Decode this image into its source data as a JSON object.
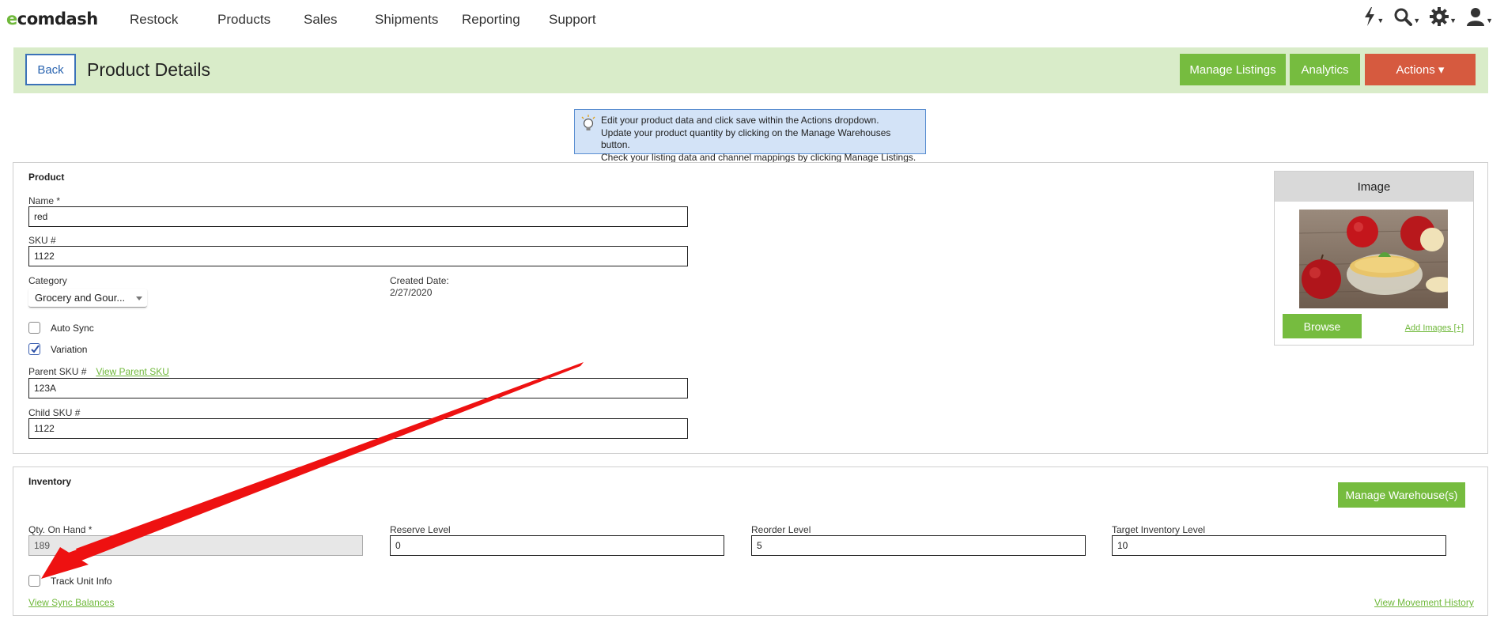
{
  "nav": {
    "logo_e": "e",
    "logo_rest": "comdash",
    "items": [
      "Restock",
      "Products",
      "Sales",
      "Shipments",
      "Reporting",
      "Support"
    ],
    "icons": [
      "lightning-icon",
      "search-icon",
      "gear-icon",
      "user-icon"
    ]
  },
  "header": {
    "back_label": "Back",
    "title": "Product Details",
    "manage_listings_label": "Manage Listings",
    "analytics_label": "Analytics",
    "actions_label": "Actions ▾"
  },
  "info": {
    "line1": "Edit your product data and click save within the Actions dropdown.",
    "line2": "Update your product quantity by clicking on the Manage Warehouses button.",
    "line3": "Check your listing data and channel mappings by clicking Manage Listings."
  },
  "product": {
    "section_title": "Product",
    "name_label": "Name *",
    "name_value": "red",
    "sku_label": "SKU #",
    "sku_value": "1122",
    "category_label": "Category",
    "category_value": "Grocery and Gour...",
    "created_label": "Created Date:",
    "created_value": "2/27/2020",
    "auto_sync_label": "Auto Sync",
    "auto_sync_checked": false,
    "variation_label": "Variation",
    "variation_checked": true,
    "parent_sku_label": "Parent SKU #",
    "view_parent_sku": "View Parent SKU",
    "parent_sku_value": "123A",
    "child_sku_label": "Child SKU #",
    "child_sku_value": "1122"
  },
  "image_panel": {
    "title": "Image",
    "browse_label": "Browse",
    "add_images_label": "Add Images [+]"
  },
  "inventory": {
    "section_title": "Inventory",
    "manage_warehouses_label": "Manage Warehouse(s)",
    "qty_label": "Qty. On Hand *",
    "qty_value": "189",
    "reserve_label": "Reserve Level",
    "reserve_value": "0",
    "reorder_label": "Reorder Level",
    "reorder_value": "5",
    "target_label": "Target Inventory Level",
    "target_value": "10",
    "track_unit_label": "Track Unit Info",
    "track_unit_checked": false,
    "view_sync_balances": "View Sync Balances",
    "view_movement_history": "View Movement History"
  },
  "colors": {
    "accent_green": "#76bc3f",
    "header_bg": "#d9ecc9",
    "actions_red": "#d65a3f",
    "annotation_arrow": "#ee1111"
  }
}
